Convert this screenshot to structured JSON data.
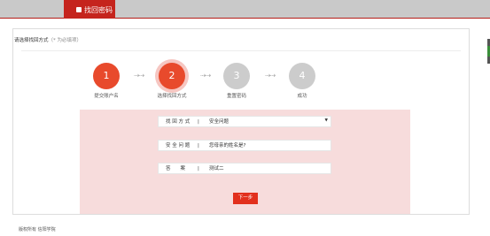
{
  "header": {
    "tab_label": "找回密码"
  },
  "panel": {
    "title": "请选择找回方式",
    "note": "（* 为必填项）"
  },
  "steps": [
    {
      "number": "1",
      "label": "提交账户名",
      "state": "done"
    },
    {
      "number": "2",
      "label": "选择找回方式",
      "state": "active"
    },
    {
      "number": "3",
      "label": "重置密码",
      "state": "todo"
    },
    {
      "number": "4",
      "label": "成功",
      "state": "todo"
    }
  ],
  "step_arrow": "⇢⇢",
  "form": {
    "method": {
      "label": "找 回 方 式",
      "separator": "|",
      "selected": "安全问题"
    },
    "question": {
      "label": "安 全 问 题",
      "separator": "|",
      "value": "您母亲的姓名是?"
    },
    "answer": {
      "label": "答　　案",
      "separator": "|",
      "value": "测试二"
    },
    "next_label": "下一步"
  },
  "footer": {
    "text": "版权所有 信阳学院"
  },
  "colors": {
    "accent": "#e84a2c",
    "header_tab": "#c5241d",
    "form_background": "#f7dcdc",
    "inactive_step": "#cccccc"
  },
  "icons": {
    "select_caret": "▼"
  }
}
